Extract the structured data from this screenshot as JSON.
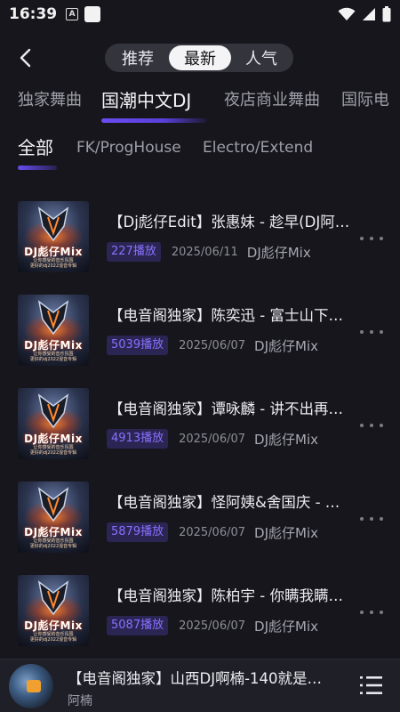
{
  "status_bar": {
    "time": "16:39",
    "notification_a": "A"
  },
  "header": {
    "tabs": [
      "推荐",
      "最新",
      "人气"
    ],
    "active_tab": "最新"
  },
  "categories": [
    "独家舞曲",
    "国潮中文DJ",
    "夜店商业舞曲",
    "国际电"
  ],
  "active_category": "国潮中文DJ",
  "sub_tabs": [
    "全部",
    "FK/ProgHouse",
    "Electro/Extend"
  ],
  "active_sub_tab": "全部",
  "cover": {
    "title": "DJ彪仔Mix",
    "caption_line1": "让你感受的音乐氛围",
    "caption_line2": "更好的dj2022混音专辑"
  },
  "tracks": [
    {
      "title": "【Dj彪仔Edit】张惠妹 - 趁早(DJ阿…",
      "plays": "227播放",
      "date": "2025/06/11",
      "artist": "DJ彪仔Mix"
    },
    {
      "title": "【电音阁独家】陈奕迅 - 富士山下…",
      "plays": "5039播放",
      "date": "2025/06/07",
      "artist": "DJ彪仔Mix"
    },
    {
      "title": "【电音阁独家】谭咏麟 - 讲不出再…",
      "plays": "4913播放",
      "date": "2025/06/07",
      "artist": "DJ彪仔Mix"
    },
    {
      "title": "【电音阁独家】怪阿姨&舍国庆 - …",
      "plays": "5879播放",
      "date": "2025/06/07",
      "artist": "DJ彪仔Mix"
    },
    {
      "title": "【电音阁独家】陈柏宇 - 你瞒我瞒…",
      "plays": "5087播放",
      "date": "2025/06/07",
      "artist": "DJ彪仔Mix"
    }
  ],
  "player": {
    "title": "【电音阁独家】山西DJ啊楠-140就是…",
    "artist": "阿楠"
  },
  "colors": {
    "background": "#16161c",
    "accent": "#6a4cf0",
    "play_badge_bg": "#2a2552",
    "play_badge_text": "#8a70ff"
  },
  "icons": {
    "back": "chevron-left-icon",
    "more": "more-dots-icon",
    "playlist": "playlist-icon",
    "wifi": "wifi-icon",
    "signal": "signal-icon",
    "battery": "battery-icon"
  }
}
